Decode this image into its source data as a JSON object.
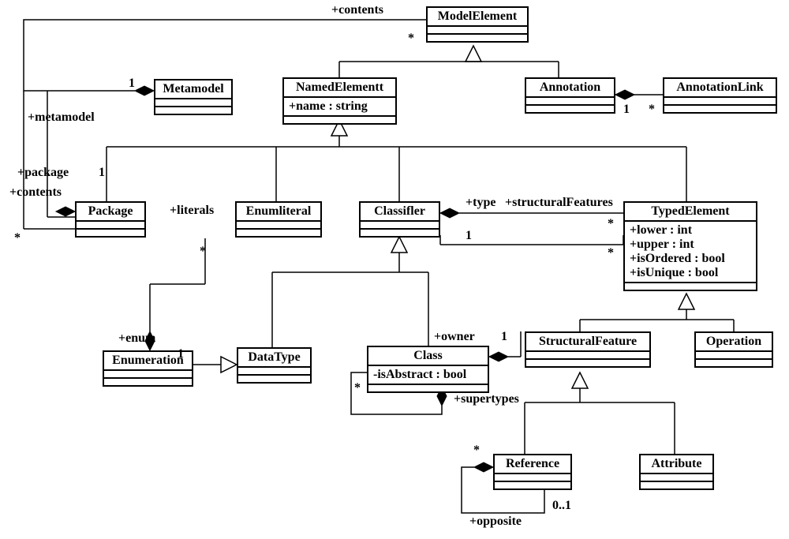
{
  "classes": {
    "ModelElement": {
      "name": "ModelElement"
    },
    "Metamodel": {
      "name": "Metamodel"
    },
    "NamedElement": {
      "name": "NamedElementt",
      "attrs": [
        "+name : string"
      ]
    },
    "Annotation": {
      "name": "Annotation"
    },
    "AnnotationLink": {
      "name": "AnnotationLink"
    },
    "Package": {
      "name": "Package"
    },
    "EnumLiteral": {
      "name": "Enumliteral"
    },
    "Classifier": {
      "name": "Classifler"
    },
    "TypedElement": {
      "name": "TypedElement",
      "attrs": [
        "+lower : int",
        "+upper : int",
        "+isOrdered : bool",
        "+isUnique : bool"
      ]
    },
    "Enumeration": {
      "name": "Enumeration"
    },
    "DataType": {
      "name": "DataType"
    },
    "Class": {
      "name": "Class",
      "attrs": [
        "-isAbstract : bool"
      ]
    },
    "StructuralFeature": {
      "name": "StructuralFeature"
    },
    "Operation": {
      "name": "Operation"
    },
    "Reference": {
      "name": "Reference"
    },
    "Attribute": {
      "name": "Attribute"
    }
  },
  "labels": {
    "contents_top": "+contents",
    "star1": "*",
    "one1": "1",
    "metamodel_role": "+metamodel",
    "package_role": "+package",
    "contents_left": "+contents",
    "star2": "*",
    "one2": "1",
    "literals": "+literals",
    "star3": "*",
    "enum_role": "+enum",
    "one3": "1",
    "type_role": "+type",
    "sf_role": "+structuralFeatures",
    "one4": "1",
    "star4": "*",
    "star5": "*",
    "owner_role": "+owner",
    "one5": "1",
    "supertypes": "+supertypes",
    "star6": "*",
    "star7": "*",
    "opposite": "+opposite",
    "zeroone": "0..1",
    "anno_one": "1",
    "anno_star": "*"
  }
}
